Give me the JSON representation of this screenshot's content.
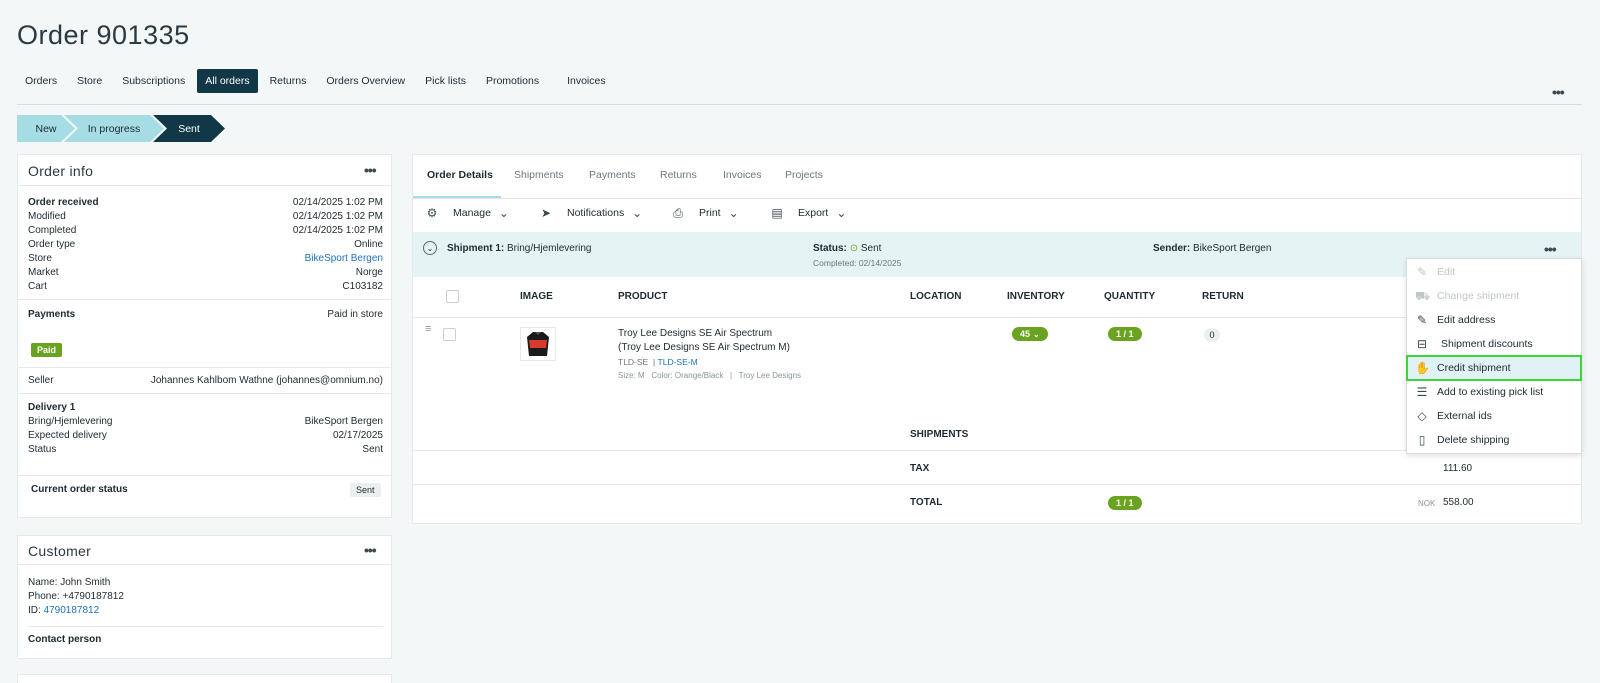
{
  "page": {
    "title": "Order 901335"
  },
  "nav": {
    "tabs": [
      {
        "label": "Orders"
      },
      {
        "label": "Store"
      },
      {
        "label": "Subscriptions"
      },
      {
        "label": "All orders"
      },
      {
        "label": "Returns"
      },
      {
        "label": "Orders Overview"
      },
      {
        "label": "Pick lists"
      },
      {
        "label": "Promotions"
      },
      {
        "label": "Invoices"
      }
    ]
  },
  "steps": [
    {
      "label": "New"
    },
    {
      "label": "In progress"
    },
    {
      "label": "Sent"
    }
  ],
  "order_info": {
    "title": "Order info",
    "rows": [
      {
        "label": "Order received",
        "value": "02/14/2025 1:02 PM"
      },
      {
        "label": "Modified",
        "value": "02/14/2025 1:02 PM"
      },
      {
        "label": "Completed",
        "value": "02/14/2025 1:02 PM"
      },
      {
        "label": "Order type",
        "value": "Online"
      },
      {
        "label": "Store",
        "value": "BikeSport Bergen"
      },
      {
        "label": "Market",
        "value": "Norge"
      },
      {
        "label": "Cart",
        "value": "C103182"
      }
    ],
    "payments_label": "Payments",
    "payments_value": "Paid in store",
    "paid_badge": "Paid",
    "seller_label": "Seller",
    "seller_value": "Johannes Kahlbom Wathne (johannes@omnium.no)",
    "delivery_title": "Delivery 1",
    "delivery_rows": [
      {
        "label": "Bring/Hjemlevering",
        "value": "BikeSport Bergen"
      },
      {
        "label": "Expected delivery",
        "value": "02/17/2025"
      },
      {
        "label": "Status",
        "value": "Sent"
      }
    ],
    "current_status_label": "Current order status",
    "current_status_value": "Sent"
  },
  "customer": {
    "title": "Customer",
    "name": "Name: John Smith",
    "phone": "Phone: +4790187812",
    "id_label": "ID:",
    "id_value": "4790187812",
    "contact_label": "Contact person"
  },
  "details": {
    "tabs": [
      {
        "label": "Order Details"
      },
      {
        "label": "Shipments"
      },
      {
        "label": "Payments"
      },
      {
        "label": "Returns"
      },
      {
        "label": "Invoices"
      },
      {
        "label": "Projects"
      }
    ],
    "toolbar": {
      "manage": "Manage",
      "notifications": "Notifications",
      "print": "Print",
      "export": "Export"
    },
    "shipment": {
      "title": "Shipment 1:",
      "method": "Bring/Hjemlevering",
      "status_label": "Status:",
      "status_value": "Sent",
      "completed": "Completed:  02/14/2025",
      "sender_label": "Sender:",
      "sender_value": "BikeSport Bergen"
    },
    "columns": {
      "image": "IMAGE",
      "product": "PRODUCT",
      "location": "LOCATION",
      "inventory": "INVENTORY",
      "quantity": "QUANTITY",
      "return": "RETURN"
    },
    "item": {
      "name_line1": "Troy Lee Designs SE Air Spectrum",
      "name_line2": "(Troy Lee Designs SE Air Spectrum M)",
      "sku": "TLD-SE",
      "sku_link": "TLD-SE-M",
      "attrs": "Size: M   Color: Orange/Black   |   Troy Lee Designs",
      "inventory": "45",
      "quantity": "1 / 1",
      "return": "0"
    },
    "summary": {
      "shipments_label": "SHIPMENTS",
      "tax_label": "TAX",
      "tax_value": "111.60",
      "total_label": "TOTAL",
      "total_qty": "1 / 1",
      "currency": "NOK",
      "total_value": "558.00"
    }
  },
  "menu": {
    "items": [
      {
        "label": "Edit",
        "icon": "pencil-icon"
      },
      {
        "label": "Change shipment",
        "icon": "truck-icon"
      },
      {
        "label": "Edit address",
        "icon": "pencil-icon"
      },
      {
        "label": "Shipment discounts",
        "icon": "discount-icon"
      },
      {
        "label": "Credit shipment",
        "icon": "credit-icon"
      },
      {
        "label": "Add to existing pick list",
        "icon": "list-icon"
      },
      {
        "label": "External ids",
        "icon": "tag-icon"
      },
      {
        "label": "Delete shipping",
        "icon": "clipboard-icon"
      }
    ]
  }
}
